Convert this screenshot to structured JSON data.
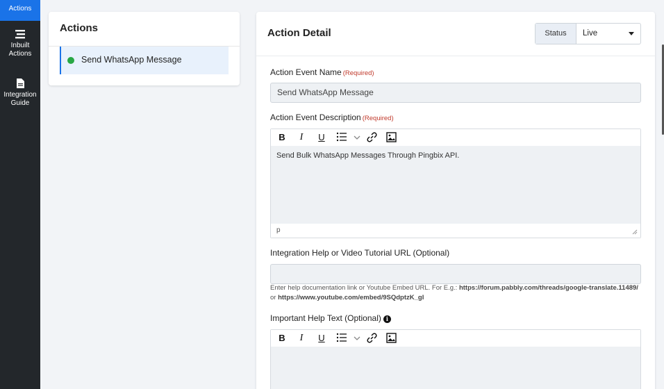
{
  "sidebar": {
    "active_label": "Actions",
    "items": [
      {
        "label": "Inbuilt Actions",
        "icon": "list-icon"
      },
      {
        "label": "Integration Guide",
        "icon": "document-icon"
      }
    ]
  },
  "actions_panel": {
    "title": "Actions",
    "items": [
      {
        "label": "Send WhatsApp Message",
        "status_color": "#28a745"
      }
    ]
  },
  "detail": {
    "title": "Action Detail",
    "status_label": "Status",
    "status_value": "Live",
    "event_name_label": "Action Event Name",
    "required_tag": "(Required)",
    "event_name_value": "Send WhatsApp Message",
    "event_desc_label": "Action Event Description",
    "event_desc_value": "Send Bulk WhatsApp Messages Through Pingbix API.",
    "editor_path": "p",
    "help_url_label": "Integration Help or Video Tutorial URL (Optional)",
    "help_url_value": "",
    "help_note_prefix": "Enter help documentation link or Youtube Embed URL. For E.g.: ",
    "help_note_link1": "https://forum.pabbly.com/threads/google-translate.11489/",
    "help_note_or": " or ",
    "help_note_link2": "https://www.youtube.com/embed/9SQdptzK_gI",
    "important_help_label": "Important Help Text (Optional)"
  },
  "colors": {
    "accent": "#1a73e8",
    "sidebar_bg": "#23272b",
    "required": "#c0392b",
    "live_dot": "#28a745"
  }
}
